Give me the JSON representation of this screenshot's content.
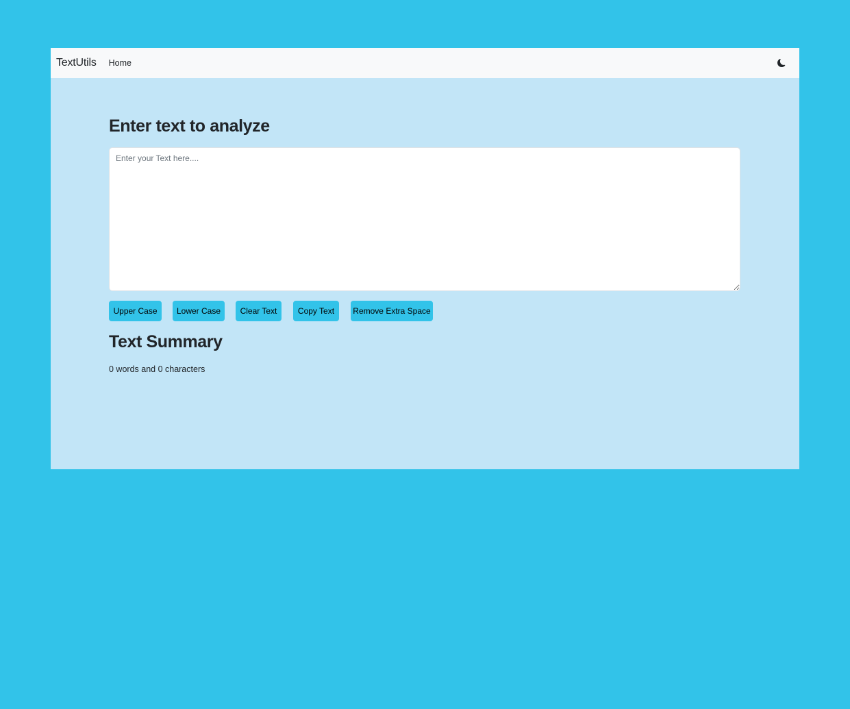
{
  "navbar": {
    "brand": "TextUtils",
    "links": [
      "Home"
    ],
    "theme_icon": "moon-icon"
  },
  "form": {
    "heading": "Enter text to analyze",
    "textarea_value": "",
    "textarea_placeholder": "Enter your Text here...."
  },
  "buttons": {
    "upper_case": "Upper Case",
    "lower_case": "Lower Case",
    "clear_text": "Clear Text",
    "copy_text": "Copy Text",
    "remove_extra_space": "Remove Extra Space"
  },
  "summary": {
    "heading": "Text Summary",
    "stats": "0 words and 0 characters"
  },
  "colors": {
    "page_background": "#32c3e9",
    "container_background": "#c2e5f7",
    "navbar_background": "#f8f9fa",
    "button_background": "#32c3e9"
  }
}
